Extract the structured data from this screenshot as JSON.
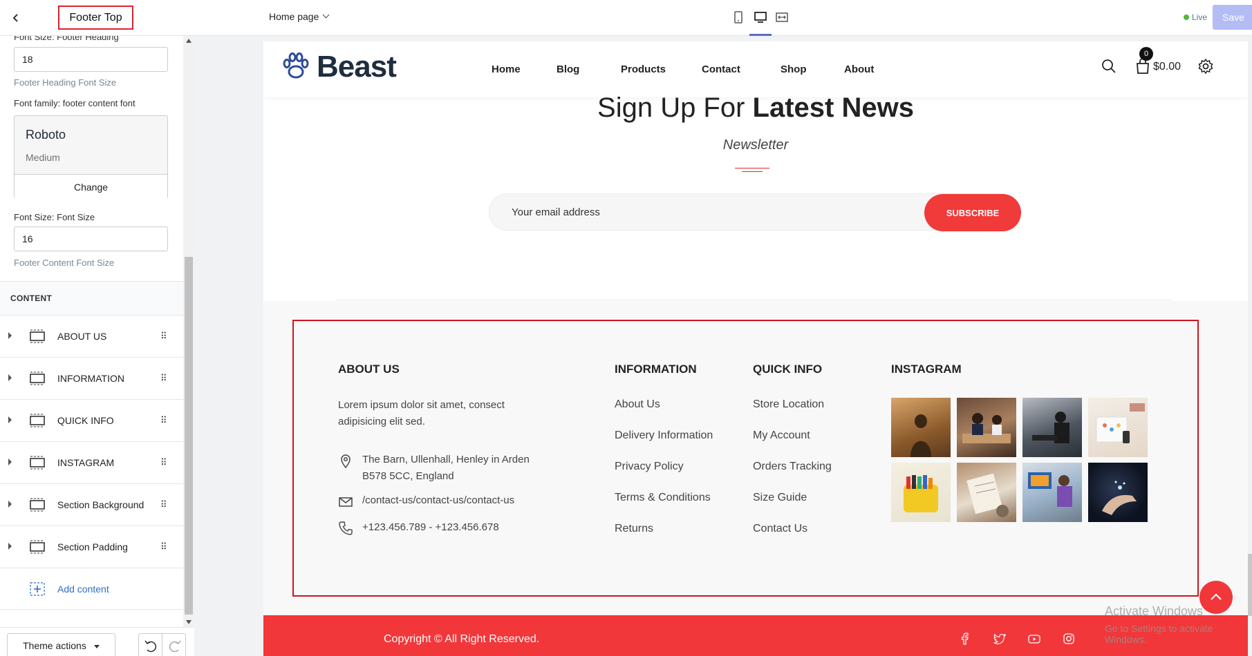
{
  "editor": {
    "panel_title": "Footer Top",
    "fields": {
      "heading_size_label": "Font Size: Footer Heading",
      "heading_size_value": "18",
      "heading_size_help": "Footer Heading Font Size",
      "font_family_label": "Font family: footer content font",
      "font_name": "Roboto",
      "font_weight": "Medium",
      "font_change": "Change",
      "font_size_label": "Font Size: Font Size",
      "font_size_value": "16",
      "font_size_help": "Footer Content Font Size"
    },
    "content_header": "CONTENT",
    "content_items": [
      {
        "label": "ABOUT US"
      },
      {
        "label": "INFORMATION"
      },
      {
        "label": "QUICK INFO"
      },
      {
        "label": "INSTAGRAM"
      },
      {
        "label": "Section Background"
      },
      {
        "label": "Section Padding"
      }
    ],
    "add_content": "Add content",
    "theme_actions": "Theme actions"
  },
  "topbar": {
    "page_select": "Home page",
    "live": "Live",
    "save": "Save"
  },
  "site": {
    "logo": "Beast",
    "nav": [
      "Home",
      "Blog",
      "Products",
      "Contact",
      "Shop",
      "About"
    ],
    "cart_count": "0",
    "cart_total": "$0.00",
    "newsletter": {
      "title_pre": "Sign Up For ",
      "title_bold": "Latest News",
      "subtitle": "Newsletter",
      "placeholder": "Your email address",
      "button": "SUBSCRIBE"
    },
    "footer": {
      "about_heading": "ABOUT US",
      "about_text_1": "Lorem ipsum dolor sit amet, consect",
      "about_text_2": "adipisicing elit sed.",
      "address_1": "The Barn, Ullenhall, Henley in Arden",
      "address_2": "B578 5CC, England",
      "email": "/contact-us/contact-us/contact-us",
      "phone": "+123.456.789 - +123.456.678",
      "info_heading": "INFORMATION",
      "info_links": [
        "About Us",
        "Delivery Information",
        "Privacy Policy",
        "Terms & Conditions",
        "Returns"
      ],
      "quick_heading": "QUICK INFO",
      "quick_links": [
        "Store Location",
        "My Account",
        "Orders Tracking",
        "Size Guide",
        "Contact Us"
      ],
      "insta_heading": "INSTAGRAM",
      "copyright": "Copyright © All Right Reserved."
    },
    "activate_1": "Activate Windows",
    "activate_2": "Go to Settings to activate Windows."
  },
  "colors": {
    "accent": "#f2373a",
    "selection": "#d0121f",
    "save": "#b3bcf5",
    "live": "#50b83c"
  }
}
